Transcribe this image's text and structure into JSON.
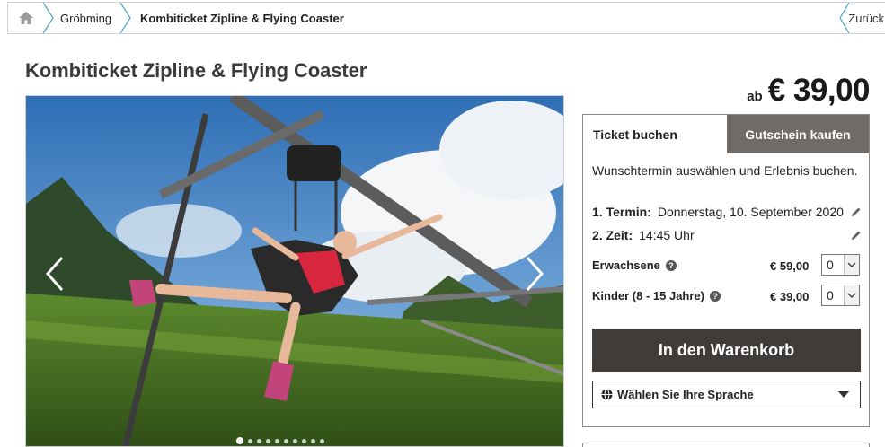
{
  "breadcrumb": {
    "items": [
      "Gröbming",
      "Kombiticket Zipline & Flying Coaster"
    ],
    "back_label": "Zurück"
  },
  "page": {
    "title": "Kombiticket Zipline & Flying Coaster",
    "price_prefix": "ab",
    "price": "€ 39,00"
  },
  "gallery": {
    "slide_count": 10,
    "active_index": 0
  },
  "booking": {
    "tabs": [
      "Ticket buchen",
      "Gutschein kaufen"
    ],
    "active_tab": "Ticket buchen",
    "intro": "Wunschtermin auswählen und Erlebnis buchen.",
    "date_label": "1. Termin:",
    "date_value": "Donnerstag, 10. September 2020",
    "time_label": "2. Zeit:",
    "time_value": "14:45 Uhr",
    "tickets": [
      {
        "label": "Erwachsene",
        "price": "€ 59,00",
        "quantity": "0"
      },
      {
        "label": "Kinder (8 - 15 Jahre)",
        "price": "€ 39,00",
        "quantity": "0"
      }
    ],
    "cart_button": "In den Warenkorb",
    "language_select": "Wählen Sie Ihre Sprache"
  },
  "colors": {
    "tab_inactive_bg": "#6e6b69",
    "button_bg": "#3f3c3a",
    "border": "#cfd4d8"
  }
}
